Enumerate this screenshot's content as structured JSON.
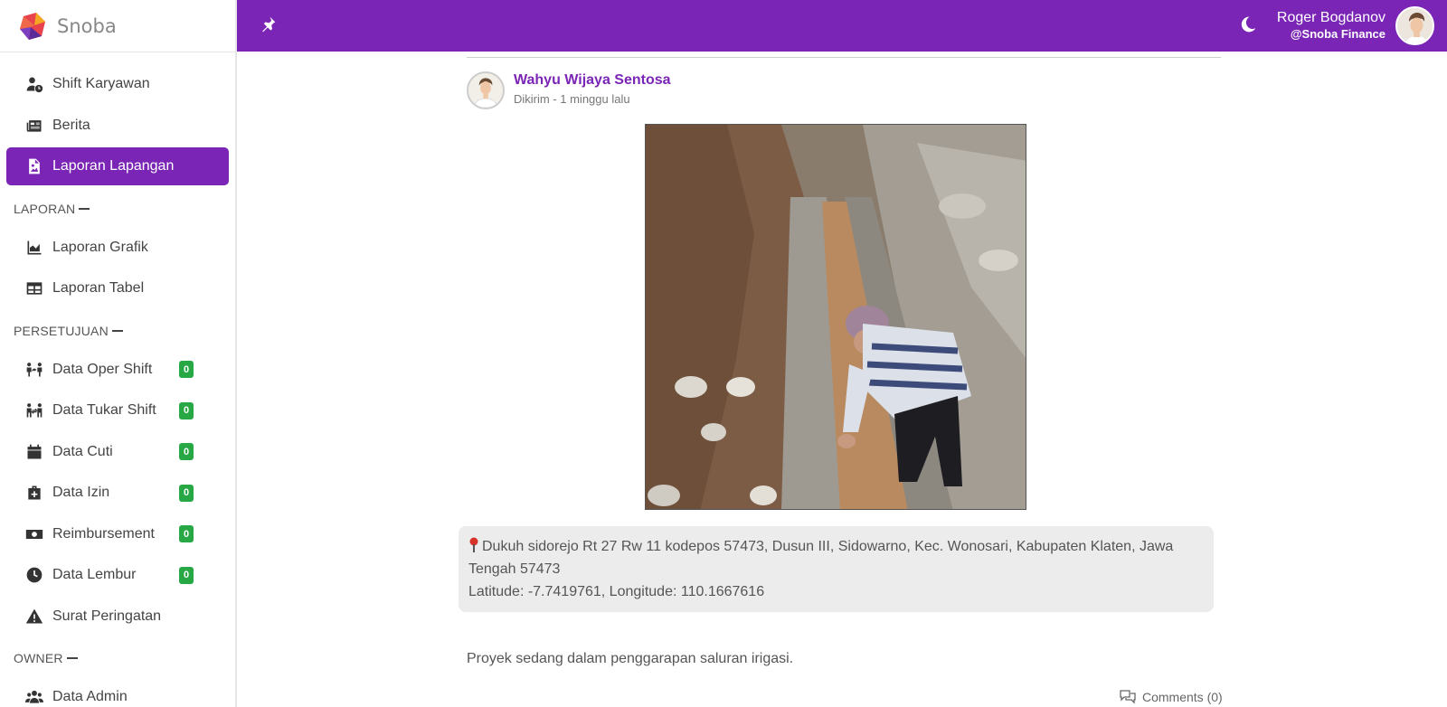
{
  "brand": {
    "name": "Snoba"
  },
  "sidebar": {
    "items_top": [
      {
        "label": "Shift Karyawan",
        "icon": "user-clock-icon",
        "active": false
      },
      {
        "label": "Berita",
        "icon": "newspaper-icon",
        "active": false
      },
      {
        "label": "Laporan Lapangan",
        "icon": "file-image-icon",
        "active": true
      }
    ],
    "section_laporan": "LAPORAN",
    "items_laporan": [
      {
        "label": "Laporan Grafik",
        "icon": "chart-area-icon"
      },
      {
        "label": "Laporan Tabel",
        "icon": "table-icon"
      }
    ],
    "section_persetujuan": "PERSETUJUAN",
    "items_persetujuan": [
      {
        "label": "Data Oper Shift",
        "icon": "people-arrows-icon",
        "badge": "0"
      },
      {
        "label": "Data Tukar Shift",
        "icon": "people-exchange-icon",
        "badge": "0"
      },
      {
        "label": "Data Cuti",
        "icon": "calendar-icon",
        "badge": "0"
      },
      {
        "label": "Data Izin",
        "icon": "medkit-icon",
        "badge": "0"
      },
      {
        "label": "Reimbursement",
        "icon": "money-bill-icon",
        "badge": "0"
      },
      {
        "label": "Data Lembur",
        "icon": "clock-icon",
        "badge": "0"
      },
      {
        "label": "Surat Peringatan",
        "icon": "warning-icon"
      }
    ],
    "section_owner": "OWNER",
    "items_owner": [
      {
        "label": "Data Admin",
        "icon": "users-icon"
      }
    ]
  },
  "topbar": {
    "user_name": "Roger Bogdanov",
    "user_org": "@Snoba Finance"
  },
  "post": {
    "author": "Wahyu Wijaya Sentosa",
    "time": "Dikirim - 1 minggu lalu",
    "address": "Dukuh sidorejo Rt 27 Rw 11 kodepos 57473, Dusun III, Sidowarno, Kec. Wonosari, Kabupaten Klaten, Jawa Tengah 57473",
    "coords": "Latitude: -7.7419761, Longitude: 110.1667616",
    "caption": "Proyek sedang dalam penggarapan saluran irigasi.",
    "comments": "Comments (0)"
  },
  "colors": {
    "accent": "#7a25b5",
    "badge": "#28a745"
  }
}
